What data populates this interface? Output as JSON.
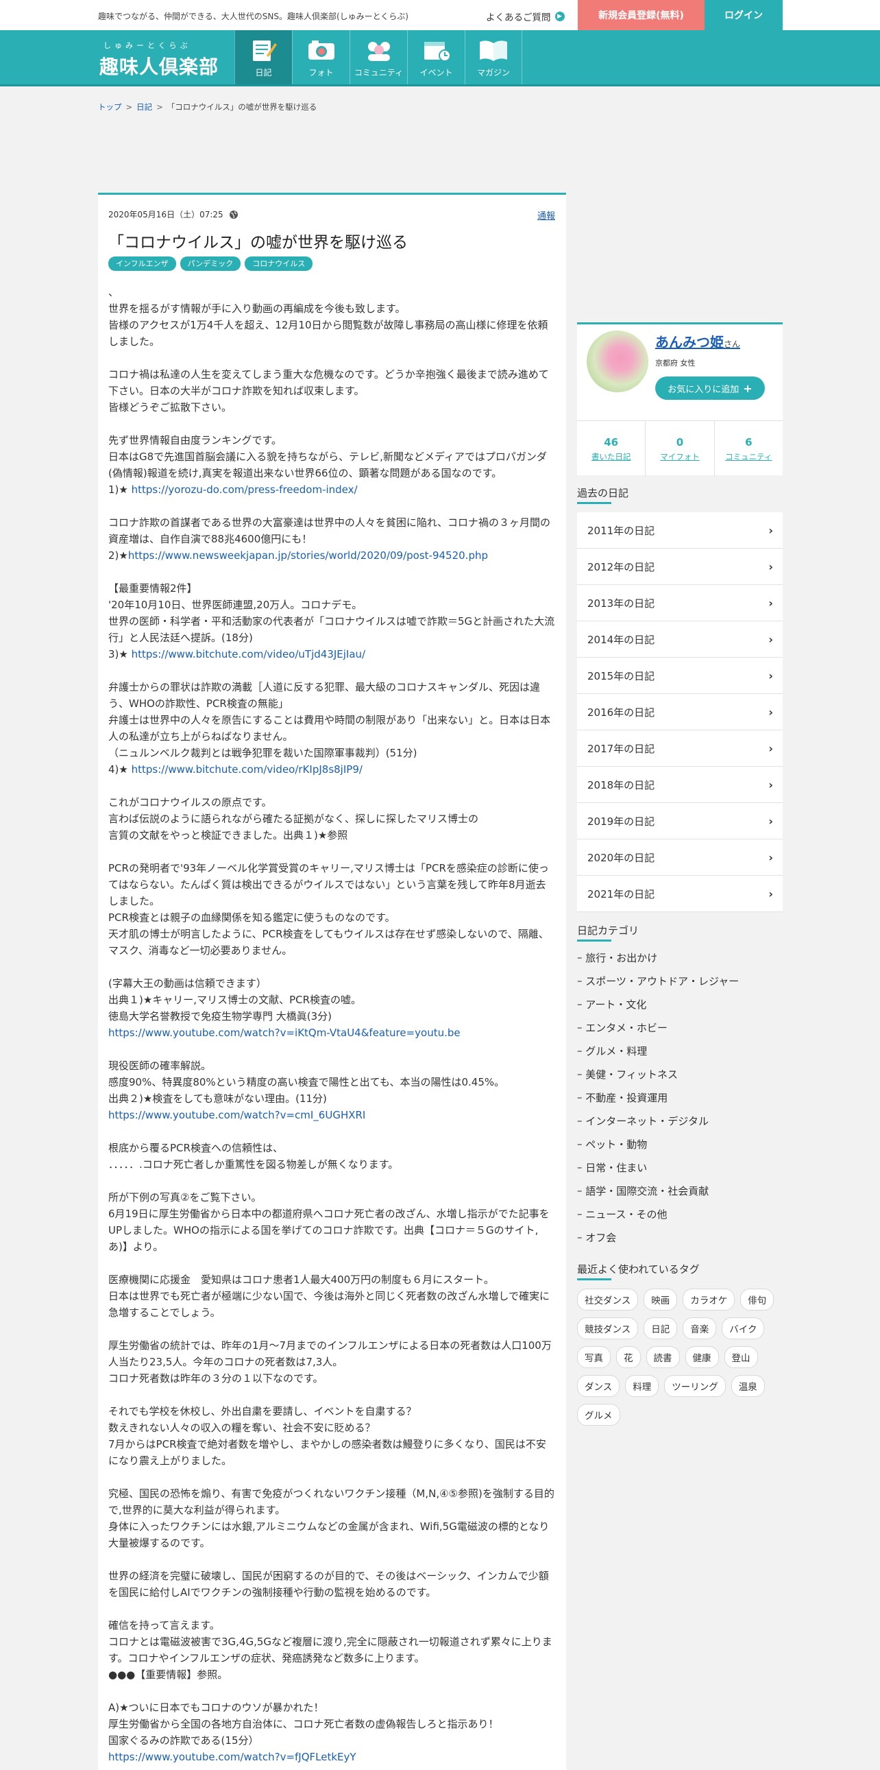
{
  "topbar": {
    "tagline": "趣味でつながる、仲間ができる、大人世代のSNS。趣味人倶楽部(しゅみーとくらぶ)",
    "faq": "よくあるご質問",
    "register": "新規会員登録(無料)",
    "login": "ログイン"
  },
  "logo": {
    "ruby": "しゅみーとくらぶ",
    "name": "趣味人倶楽部"
  },
  "nav": [
    {
      "label": "日記",
      "icon": "diary-icon"
    },
    {
      "label": "フォト",
      "icon": "camera-icon"
    },
    {
      "label": "コミュニティ",
      "icon": "community-icon"
    },
    {
      "label": "イベント",
      "icon": "calendar-icon"
    },
    {
      "label": "マガジン",
      "icon": "magazine-icon"
    }
  ],
  "breadcrumb": {
    "top": "トップ",
    "diary": "日記",
    "current": "「コロナウイルス」の嘘が世界を駆け巡る"
  },
  "article": {
    "date": "2020年05月16日（土）07:25",
    "report": "通報",
    "title": "「コロナウイルス」の嘘が世界を駆け巡る",
    "tags": [
      "インフルエンザ",
      "パンデミック",
      "コロナウイルス"
    ],
    "lines": [
      "、",
      "世界を揺るがす情報が手に入り動画の再編成を今後も致します。",
      "皆様のアクセスが1万4千人を超え、12月10日から閲覧数が故障し事務局の高山様に修理を依頼しました。",
      "",
      "コロナ禍は私達の人生を変えてしまう重大な危機なのです。どうか辛抱強く最後まで読み進めて下さい。日本の大半がコロナ詐欺を知れば収束します。",
      "皆様どうぞご拡散下さい。",
      "",
      "先ず世界情報自由度ランキングです。",
      "日本はG8で先進国首脳会議に入る貌を持ちながら、テレビ,新聞などメディアではプロパガンダ(偽情報)報道を続け,真実を報道出来ない世界66位の、顕著な問題がある国なのです。",
      "1)★ |https://yorozu-do.com/press-freedom-index/",
      "",
      "コロナ詐欺の首謀者である世界の大富豪達は世界中の人々を貧困に陥れ、コロナ禍の３ヶ月間の資産増は、自作自演で88兆4600億円にも！",
      "2)★|https://www.newsweekjapan.jp/stories/world/2020/09/post-94520.php",
      "",
      "【最重要情報2件】",
      "'20年10月10日、世界医師連盟,20万人。コロナデモ。",
      "世界の医師・科学者・平和活動家の代表者が「コロナウイルスは嘘で詐欺＝5Gと計画された大流行」と人民法廷へ提訴。(18分)",
      "3)★ |https://www.bitchute.com/video/uTjd43JEjIau/",
      "",
      "弁護士からの罪状は詐欺の満載［人道に反する犯罪、最大級のコロナスキャンダル、死因は違う、WHOの詐欺性、PCR検査の無能」",
      "弁護士は世界中の人々を原告にすることは費用や時間の制限があり「出来ない」と。日本は日本人の私達が立ち上がらねばなりません。",
      "（ニュルンベルク裁判とは戦争犯罪を裁いた国際軍事裁判）(51分)",
      "4)★ |https://www.bitchute.com/video/rKIpJ8s8jIP9/",
      "",
      "これがコロナウイルスの原点です。",
      "言わば伝説のように語られながら確たる証拠がなく、探しに探したマリス博士の",
      "言質の文献をやっと検証できました。出典１)★参照",
      "",
      "PCRの発明者で'93年ノーベル化学賞受賞のキャリー,マリス博士は「PCRを感染症の診断に使ってはならない。たんぱく質は検出できるがウイルスではない」という言葉を残して昨年8月逝去しました。",
      "PCR検査とは親子の血縁関係を知る鑑定に使うものなのです。",
      "天才肌の博士が明言したように、PCR検査をしてもウイルスは存在せず感染しないので、隔離、マスク、消毒など一切必要ありません。",
      "",
      "(字幕大王の動画は信頼できます）",
      "出典１)★キャリー,マリス博士の文献、PCR検査の嘘。",
      "徳島大学名誉教授で免疫生物学専門 大橋眞(3分)",
      "|https://www.youtube.com/watch?v=iKtQm-VtaU4&feature=youtu.be",
      "",
      "現役医師の確率解説。",
      "感度90%、特異度80%という精度の高い検査で陽性と出ても、本当の陽性は0.45%。",
      "出典２)★検査をしても意味がない理由。(11分)",
      "|https://www.youtube.com/watch?v=cmI_6UGHXRI",
      "",
      "根底から覆るPCR検査への信頼性は、",
      "．．．．．.コロナ死亡者しか重篤性を図る物差しが無くなります。",
      "",
      "所が下例の写真②をご覧下さい。",
      "6月19日に厚生労働省から日本中の都道府県へコロナ死亡者の改ざん、水増し指示がでた記事をUPしました。WHOの指示による国を挙げてのコロナ詐欺です。出典【コロナ＝５Gのサイト,あ)】より。",
      "",
      "医療機関に応援金　愛知県はコロナ患者1人最大400万円の制度も６月にスタート。",
      "日本は世界でも死亡者が極端に少ない国で、今後は海外と同じく死者数の改ざん水増しで確実に急増することでしょう。",
      "",
      "厚生労働省の統計では、昨年の1月～7月までのインフルエンザによる日本の死者数は人口100万人当たり23,5人。今年のコロナの死者数は7,3人。",
      "コロナ死者数は昨年の３分の１以下なのです。",
      "",
      "それでも学校を休校し、外出自粛を要請し、イベントを自粛する？",
      "数えきれない人々の収入の糧を奪い、社会不安に貶める？",
      "7月からはPCR検査で絶対者数を増やし、まやかしの感染者数は鰻登りに多くなり、国民は不安になり震え上がりました。",
      "",
      "究極、国民の恐怖を煽り、有害で免疫がつくれないワクチン接種（M,N,④⑤参照)を強制する目的で,世界的に莫大な利益が得られます。",
      "身体に入ったワクチンには水銀,アルミニウムなどの金属が含まれ、Wifi,5G電磁波の標的となり大量被爆するのです。",
      "",
      "世界の経済を完璧に破壊し、国民が困窮するのが目的で、その後はベーシック、インカムで少額を国民に給付しAIでワクチンの強制接種や行動の監視を始めるのです。",
      "",
      "確信を持って言えます。",
      "コロナとは電磁波被害で3G,4G,5Gなど複層に渡り,完全に隠蔽され一切報道されず累々に上ります。コロナやインフルエンザの症状、発癌誘発など数多に上ります。",
      "●●●【重要情報】参照。",
      "",
      "A)★ついに日本でもコロナのウソが暴かれた！",
      "厚生労働省から全国の各地方自治体に、コロナ死亡者数の虚偽報告しろと指示あり！",
      "国家ぐるみの詐欺である(15分）",
      "|https://www.youtube.com/watch?v=fJQFLetkEyY"
    ]
  },
  "profile": {
    "name": "あんみつ姫",
    "suffix": "さん",
    "location": "京都府 女性",
    "fav_button": "お気に入りに追加",
    "stats": [
      {
        "num": "46",
        "label": "書いた日記"
      },
      {
        "num": "0",
        "label": "マイフォト"
      },
      {
        "num": "6",
        "label": "コミュニティ"
      }
    ]
  },
  "past": {
    "heading": "過去の日記",
    "years": [
      "2011年の日記",
      "2012年の日記",
      "2013年の日記",
      "2014年の日記",
      "2015年の日記",
      "2016年の日記",
      "2017年の日記",
      "2018年の日記",
      "2019年の日記",
      "2020年の日記",
      "2021年の日記"
    ]
  },
  "categories": {
    "heading": "日記カテゴリ",
    "items": [
      "旅行・お出かけ",
      "スポーツ・アウトドア・レジャー",
      "アート・文化",
      "エンタメ・ホビー",
      "グルメ・料理",
      "美健・フィットネス",
      "不動産・投資運用",
      "インターネット・デジタル",
      "ペット・動物",
      "日常・住まい",
      "語学・国際交流・社会貢献",
      "ニュース・その他",
      "オフ会"
    ]
  },
  "tagcloud": {
    "heading": "最近よく使われているタグ",
    "items": [
      "社交ダンス",
      "映画",
      "カラオケ",
      "俳句",
      "競技ダンス",
      "日記",
      "音楽",
      "バイク",
      "写真",
      "花",
      "読書",
      "健康",
      "登山",
      "ダンス",
      "料理",
      "ツーリング",
      "温泉",
      "グルメ"
    ]
  }
}
